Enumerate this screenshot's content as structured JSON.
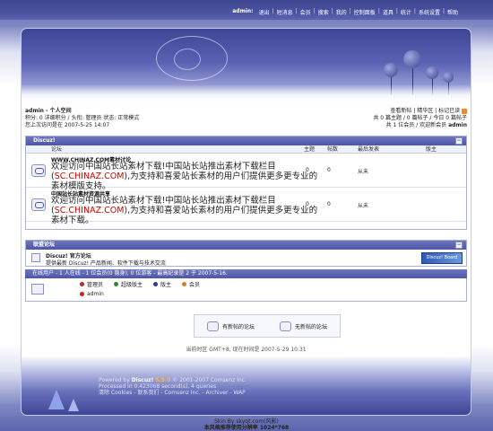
{
  "topnav": {
    "user": "admin:",
    "links": [
      "退出",
      "短消息",
      "会员",
      "搜索",
      "我的",
      "控制面板",
      "道具",
      "统计",
      "系统设置",
      "帮助"
    ]
  },
  "member": {
    "title": "admin - 个人空间",
    "stats_line": "积分: 0 详细积分 / 头衔: 管理员 状态: 正常模式",
    "last_visit": "您上次访问是在 2007-5-25 14:07",
    "right_links": "查看新帖 | 精华区 | 标记已读",
    "right_stats_1": "共 0 篇主题 / 0 篇帖子 / 今日 0 篇帖子",
    "right_stats_2": "共 1 位会员 / 欢迎新会员",
    "newest_member": "admin"
  },
  "forum_panel": {
    "title": "Discuz!",
    "columns": {
      "forum": "论坛",
      "topics": "主题",
      "posts": "帖数",
      "last_post": "最后发表",
      "moderator": "版主"
    },
    "forums": [
      {
        "name": "WWW.CHINAZ.COM素材讨论",
        "desc_1": "欢迎访问中国站长站素材下载!中国站长站推出素材下载栏目(",
        "desc_link": "SC.CHINAZ.COM",
        "desc_2": "),为支持和喜爱站长素材的用户们提供更多更专业的素材模版支持。",
        "topics": "0",
        "posts": "0",
        "last_post": "从未"
      },
      {
        "name": "中国站长站素材资源共享",
        "desc_1": "欢迎访问中国站长站素材下载!中国站长站推出素材下载栏目(",
        "desc_link": "SC.CHINAZ.COM",
        "desc_2": "),为支持和喜爱站长素材的用户们提供更多更专业的素材下载。",
        "topics": "0",
        "posts": "0",
        "last_post": "从未"
      }
    ]
  },
  "partner_panel": {
    "title": "联盟论坛",
    "name": "Discuz! 官方论坛",
    "desc": "提供最新 Discuz! 产品新闻、软件下载与技术交流",
    "logo_text": "Discuz! Board"
  },
  "online": {
    "header": "在线用户 - 1 人在线 - 1 位会员(0 隐身), 0 位游客 - 最高纪录是 2 于 2007-5-16.",
    "legend": [
      "管理员",
      "超级版主",
      "版主",
      "会员"
    ],
    "legend_colors": [
      "#d02020",
      "#2a8a2a",
      "#2a3a9a",
      "#d08020"
    ],
    "users": [
      "admin"
    ]
  },
  "bottom_buttons": [
    "有新帖的论坛",
    "无新帖的论坛"
  ],
  "timeline": "当前时区 GMT+8, 现在时间是 2007-5-29 10:31",
  "footer": {
    "line1_pre": "Powered by",
    "brand": "Discuz!",
    "version": "5.5.0",
    "line1_post": "© 2001-2007 Comsenz Inc.",
    "line2": "Processed in 0.423068 second(s), 4 queries",
    "line3": "清除 Cookies - 联系我们 - Comsenz Inc. - Archiver - WAP"
  },
  "skin": {
    "line1": "Skin By skyqt.com(风影)",
    "line2": "本风格推荐使用分辨率 1024*768"
  }
}
